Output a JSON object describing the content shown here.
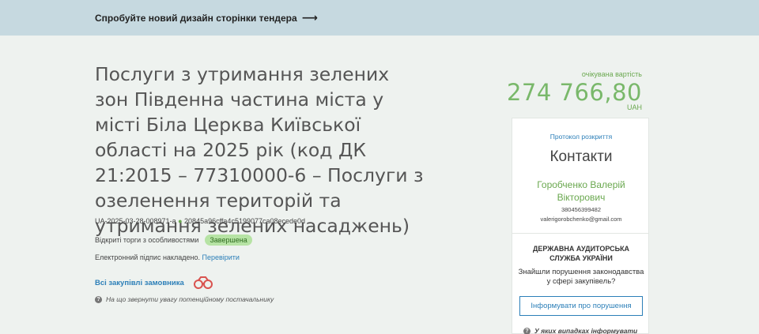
{
  "banner": {
    "link_text": "Спробуйте новий дизайн сторінки тендера",
    "arrow": "⟶"
  },
  "tender": {
    "title": "Послуги з утримання зелених зон Південна частина міста у місті Біла Церква Київської області на 2025 рік (код ДК 21:2015 – 77310000-6 – Послуги з озеленення територій та утримання зелених насаджень)",
    "id": "UA-2025-03-28-008971-a",
    "hash": "20845a96cffa4c5199077ca08ecede0d",
    "procedure": "Відкриті торги з особливостями",
    "status_badge": "Завершена",
    "signature_text": "Електронний підпис накладено.",
    "verify_link": "Перевірити",
    "all_purchases_link": "Всі закупівлі замовника",
    "hint": "На що звернути увагу потенційному постачальнику"
  },
  "price": {
    "label": "очікувана вартість",
    "value": "274 766,80",
    "currency": "UAH"
  },
  "contacts_panel": {
    "protocol_link": "Протокол розкриття",
    "title": "Контакти",
    "name": "Горобченко Валерій Вікторович",
    "phone": "380456399482",
    "email": "valerigorobchenko@gmail.com",
    "audit_title": "ДЕРЖАВНА АУДИТОРСЬКА СЛУЖБА УКРАЇНИ",
    "audit_text": "Знайшли порушення законодавства у сфері закупівель?",
    "report_button": "Інформувати про порушення",
    "bottom_hint": "У яких випадках інформувати"
  },
  "icons": {
    "binoculars": "binoculars-icon",
    "question": "question-icon"
  },
  "colors": {
    "banner_bg": "#c6d9e0",
    "page_bg": "#eef2ef",
    "accent_green": "#79b86a",
    "link_blue": "#2c7fb8",
    "badge_bg": "#b6e3a4"
  }
}
